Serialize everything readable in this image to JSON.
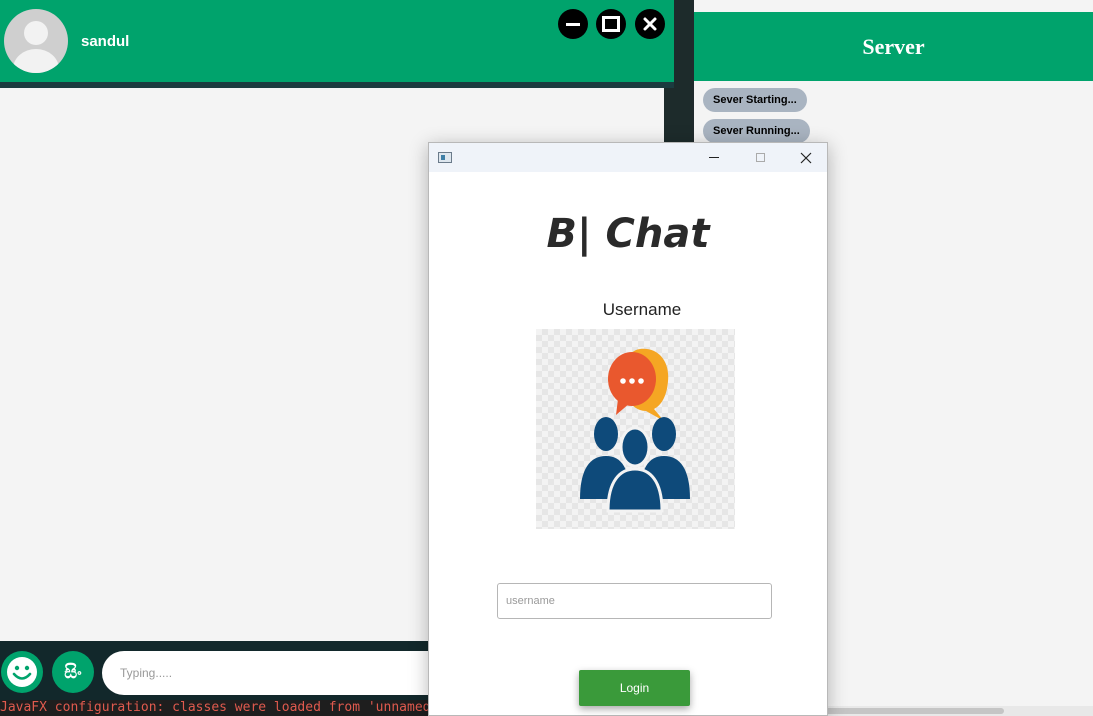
{
  "chat": {
    "contact_name": "sandul",
    "typing_placeholder": "Typing.....",
    "sinhala_button_label": "සිං",
    "console_text": "JavaFX configuration: classes were loaded from 'unnamed"
  },
  "server": {
    "title": "Server",
    "status_messages": [
      "Sever Starting...",
      "Sever Running..."
    ]
  },
  "login": {
    "app_title": "B| Chat",
    "username_label": "Username",
    "username_placeholder": "username",
    "login_label": "Login"
  },
  "colors": {
    "accent_green": "#00a36c",
    "login_button": "#3a9a3a",
    "status_pill": "#a9b4c1"
  },
  "icons": [
    "avatar-icon",
    "minimize-icon",
    "maximize-icon",
    "close-icon",
    "emoji-icon",
    "chat-group-logo"
  ]
}
